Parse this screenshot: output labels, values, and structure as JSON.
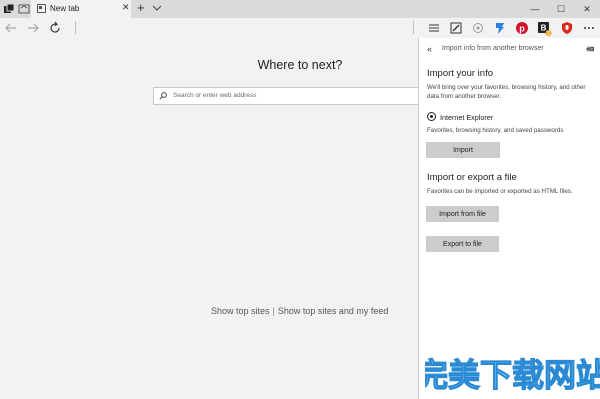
{
  "tab": {
    "title": "New tab"
  },
  "new_tab_button": "+",
  "window_controls": {
    "minimize": "—",
    "maximize": "☐",
    "close": "✕"
  },
  "ntp": {
    "heading": "Where to next?",
    "search_placeholder": "Search or enter web address",
    "top_sites_link": "Show top sites",
    "separator": "|",
    "top_sites_feed_link": "Show top sites and my feed"
  },
  "pane": {
    "back_icon": "«",
    "title": "Import info from another browser",
    "import_heading": "Import your info",
    "import_desc": "We'll bring over your favorites, browsing history, and other data from another browser.",
    "browser_option": "Internet Explorer",
    "browser_option_desc": "Favorites, browsing history, and saved passwords",
    "import_button": "Import",
    "file_heading": "Import or export a file",
    "file_desc": "Favorites can be imported or exported as HTML files.",
    "import_file_button": "Import from file",
    "export_file_button": "Export to file"
  },
  "toolbar": {
    "badge_count": "3"
  },
  "watermark": "完美下载网站",
  "colors": {
    "accent": "#0078d7",
    "pane_bg": "#ffffff",
    "page_bg": "#f2f2f2",
    "button_bg": "#cccccc"
  }
}
